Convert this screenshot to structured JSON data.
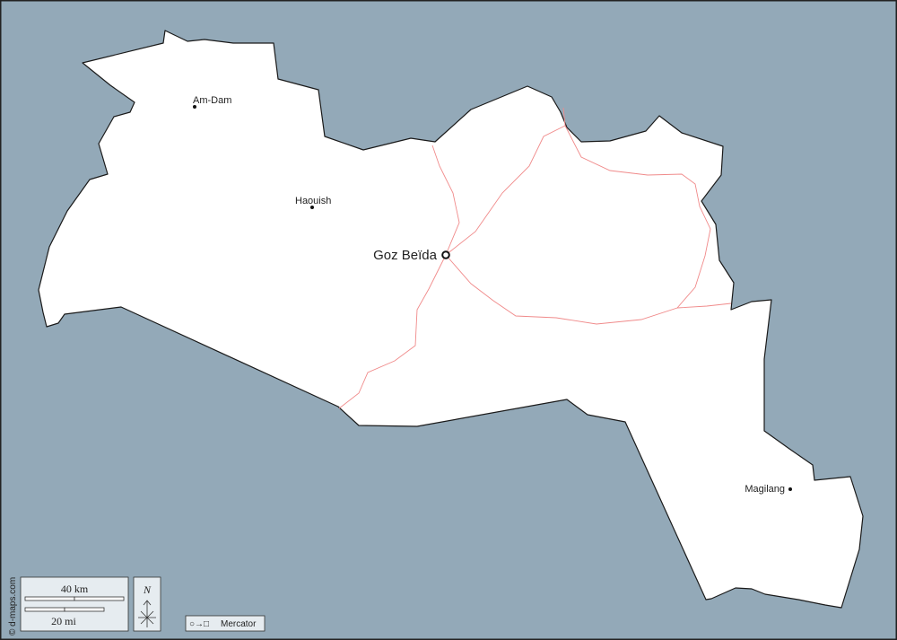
{
  "map": {
    "colors": {
      "water": "#93a9b8",
      "land": "#ffffff",
      "border": "#1a1a1a",
      "roads": "#f08a8a",
      "frame": "#222222"
    },
    "places": [
      {
        "name": "Am-Dam",
        "kind": "town"
      },
      {
        "name": "Haouish",
        "kind": "town"
      },
      {
        "name": "Goz Beïda",
        "kind": "capital"
      },
      {
        "name": "Magilang",
        "kind": "town"
      }
    ],
    "scale_bar": {
      "km_label": "40 km",
      "mi_label": "20 mi"
    },
    "north_arrow": {
      "label": "N"
    },
    "projection": {
      "label": "Mercator",
      "symbol": "○→□"
    },
    "credit": "© d-maps.com"
  }
}
